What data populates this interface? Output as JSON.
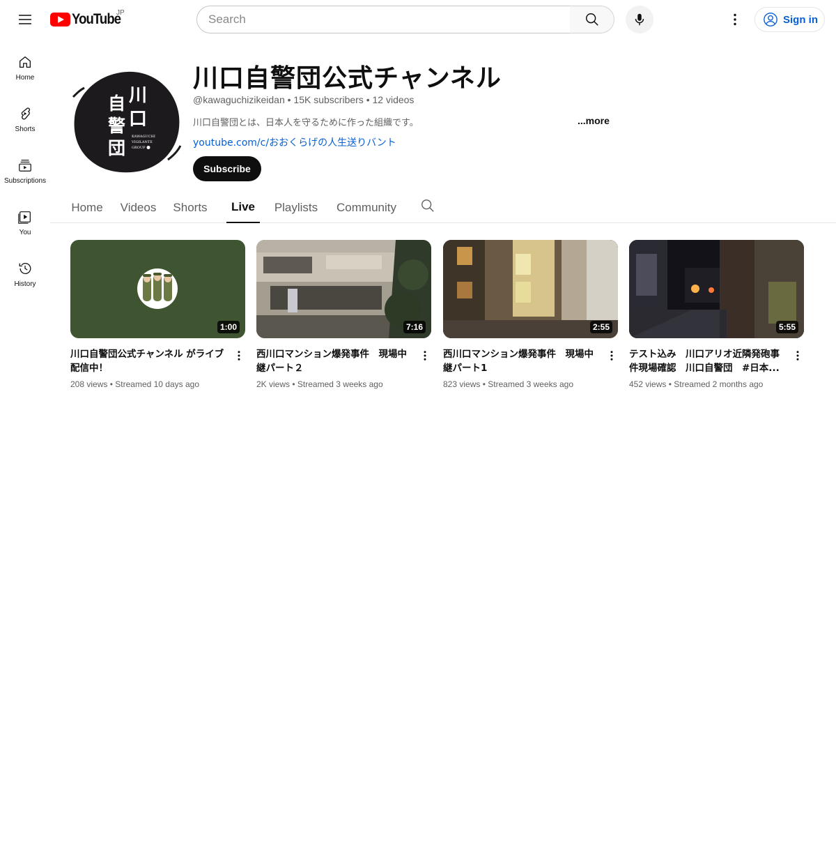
{
  "header": {
    "logo_text": "YouTube",
    "region": "JP",
    "search_placeholder": "Search",
    "signin_label": "Sign in"
  },
  "sidebar": {
    "items": [
      {
        "label": "Home",
        "icon": "home-icon"
      },
      {
        "label": "Shorts",
        "icon": "shorts-icon"
      },
      {
        "label": "Subscriptions",
        "icon": "subscriptions-icon"
      },
      {
        "label": "You",
        "icon": "you-icon"
      },
      {
        "label": "History",
        "icon": "history-icon"
      }
    ]
  },
  "channel": {
    "title": "川口自警団公式チャンネル",
    "handle": "@kawaguchizikeidan",
    "subscribers": "15K subscribers",
    "videos": "12 videos",
    "description": "川口自警団とは、日本人を守るために作った組織です。",
    "more_label": "...more",
    "link": "youtube.com/c/おおくらげの人生送りバント",
    "subscribe_label": "Subscribe",
    "avatar_text": {
      "kanji": [
        "川",
        "口",
        "自",
        "警",
        "団"
      ],
      "english": [
        "KAWAGUCHI",
        "VIGILANTE",
        "GROUP"
      ]
    }
  },
  "tabs": [
    {
      "label": "Home",
      "active": false
    },
    {
      "label": "Videos",
      "active": false
    },
    {
      "label": "Shorts",
      "active": false
    },
    {
      "label": "Live",
      "active": true
    },
    {
      "label": "Playlists",
      "active": false
    },
    {
      "label": "Community",
      "active": false
    }
  ],
  "videos": [
    {
      "title": "川口自警団公式チャンネル がライブ配信中！",
      "duration": "1:00",
      "views": "208 views",
      "streamed": "Streamed 10 days ago"
    },
    {
      "title": "西川口マンション爆発事件　現場中継パート２",
      "duration": "7:16",
      "views": "2K views",
      "streamed": "Streamed 3 weeks ago"
    },
    {
      "title": "西川口マンション爆発事件　現場中継パート1",
      "duration": "2:55",
      "views": "823 views",
      "streamed": "Streamed 3 weeks ago"
    },
    {
      "title": "テスト込み　川口アリオ近隣発砲事件現場確認　川口自警団　#日本...",
      "duration": "5:55",
      "views": "452 views",
      "streamed": "Streamed 2 months ago"
    }
  ],
  "colors": {
    "accent_blue": "#065fd4",
    "logo_red": "#ff0000",
    "text_primary": "#0f0f0f",
    "text_secondary": "#606060"
  }
}
